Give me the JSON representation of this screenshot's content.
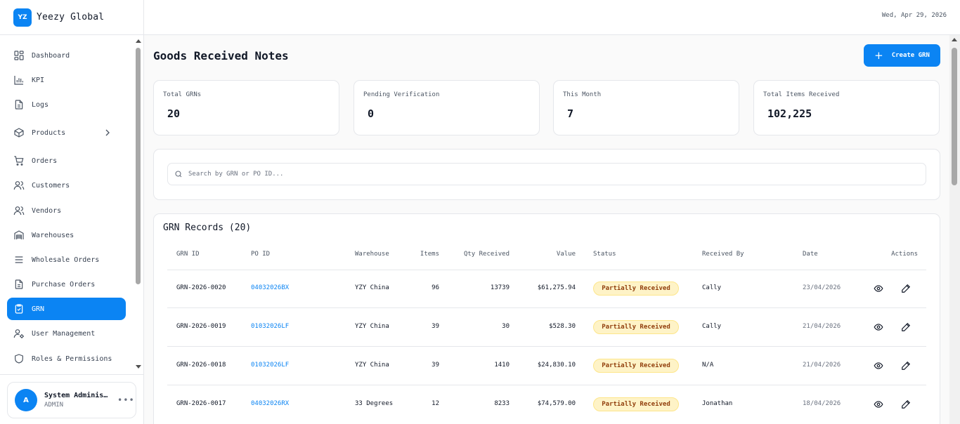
{
  "brand": {
    "logo_text": "YZ",
    "name": "Yeezy Global"
  },
  "topbar": {
    "date": "Wed, Apr 29, 2026"
  },
  "sidebar": {
    "items": [
      {
        "label": "Dashboard",
        "icon": "grid-icon"
      },
      {
        "label": "KPI",
        "icon": "bar-chart-icon"
      },
      {
        "label": "Logs",
        "icon": "document-icon"
      },
      {
        "label": "Products",
        "icon": "package-icon"
      },
      {
        "label": "Orders",
        "icon": "cart-icon"
      },
      {
        "label": "Customers",
        "icon": "users-icon"
      },
      {
        "label": "Vendors",
        "icon": "users-icon"
      },
      {
        "label": "Warehouses",
        "icon": "warehouse-icon"
      },
      {
        "label": "Wholesale Orders",
        "icon": "list-icon"
      },
      {
        "label": "Purchase Orders",
        "icon": "document-icon"
      },
      {
        "label": "GRN",
        "icon": "clipboard-check-icon",
        "active": true
      },
      {
        "label": "User Management",
        "icon": "user-cog-icon"
      },
      {
        "label": "Roles & Permissions",
        "icon": "shield-icon"
      }
    ]
  },
  "user": {
    "avatar": "A",
    "name": "System Adminis…",
    "role": "ADMIN",
    "more": "•••"
  },
  "page": {
    "title": "Goods Received Notes",
    "create_label": "Create GRN",
    "create_icon": "+"
  },
  "stats": [
    {
      "label": "Total GRNs",
      "value": "20"
    },
    {
      "label": "Pending Verification",
      "value": "0"
    },
    {
      "label": "This Month",
      "value": "7"
    },
    {
      "label": "Total Items Received",
      "value": "102,225"
    }
  ],
  "search": {
    "placeholder": "Search by GRN or PO ID...",
    "value": ""
  },
  "records": {
    "title": "GRN Records (20)",
    "columns": [
      "GRN ID",
      "PO ID",
      "Warehouse",
      "Items",
      "Qty Received",
      "Value",
      "Status",
      "Received By",
      "Date",
      "Actions"
    ],
    "rows": [
      {
        "grn_id": "GRN-2026-0020",
        "po_id": "04032026BX",
        "warehouse": "YZY China",
        "items": "96",
        "qty": "13739",
        "value": "$61,275.94",
        "status": "Partially Received",
        "received_by": "Cally",
        "date": "23/04/2026"
      },
      {
        "grn_id": "GRN-2026-0019",
        "po_id": "01032026LF",
        "warehouse": "YZY China",
        "items": "39",
        "qty": "30",
        "value": "$528.30",
        "status": "Partially Received",
        "received_by": "Cally",
        "date": "21/04/2026"
      },
      {
        "grn_id": "GRN-2026-0018",
        "po_id": "01032026LF",
        "warehouse": "YZY China",
        "items": "39",
        "qty": "1410",
        "value": "$24,830.10",
        "status": "Partially Received",
        "received_by": "N/A",
        "date": "21/04/2026"
      },
      {
        "grn_id": "GRN-2026-0017",
        "po_id": "04032026RX",
        "warehouse": "33 Degrees",
        "items": "12",
        "qty": "8233",
        "value": "$74,579.00",
        "status": "Partially Received",
        "received_by": "Jonathan",
        "date": "18/04/2026"
      }
    ]
  },
  "colors": {
    "accent": "#0b84f3",
    "badge_bg": "#fef3c7",
    "badge_text": "#92400e",
    "border": "#e5e7eb"
  }
}
